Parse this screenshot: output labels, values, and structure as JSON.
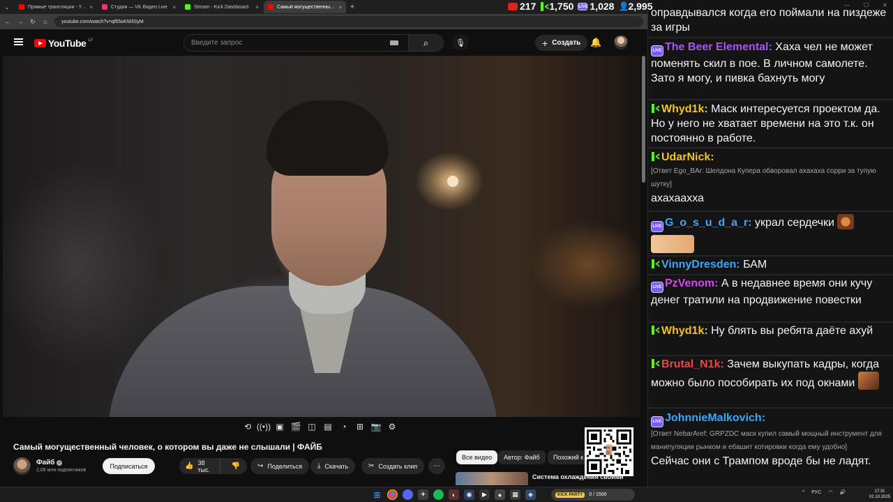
{
  "browser": {
    "tabs": [
      {
        "label": "Прямые трансляции - YouTube",
        "color": "#ff0000"
      },
      {
        "label": "Студия — VK Видео Live",
        "color": "#ff3366"
      },
      {
        "label": "Stream - Kick Dashboard",
        "color": "#53fc18"
      },
      {
        "label": "Самый могущественный ч",
        "color": "#ff0000",
        "active": true
      }
    ],
    "url": "youtube.com/watch?v=qf65oKM3SyM"
  },
  "counters": [
    {
      "platform": "youtube",
      "value": "217"
    },
    {
      "platform": "kick",
      "value": "1,750"
    },
    {
      "platform": "vk-live",
      "value": "1,028",
      "badge": "LIVE"
    },
    {
      "platform": "viewers-total",
      "value": "2,995"
    }
  ],
  "youtube": {
    "logo": "YouTube",
    "region": "LV",
    "search_placeholder": "Введите запрос",
    "create_label": "Создать",
    "video_title": "Самый могущественный человек, о котором вы даже не слышали | ФАЙБ",
    "channel_name": "Файб",
    "channel_subs": "2,08 млн подписчиков",
    "subscribe_label": "Подписаться",
    "likes": "38 тыс.",
    "share_label": "Поделиться",
    "download_label": "Скачать",
    "clip_label": "Создать клип",
    "chips": [
      "Все видео",
      "Автор: Файб",
      "Похожий к"
    ],
    "related_title": "Система охлаждения своими"
  },
  "chat": {
    "messages": [
      {
        "platform": "none",
        "user": "",
        "color": "#ffffff",
        "text": "оправдывался когда его поймали на пиздеже за игры",
        "reply": ""
      },
      {
        "platform": "vk",
        "user": "The Beer Elemental:",
        "color": "#a855f7",
        "text": "Хаха чел не может поменять скил в пое. В личном самолете. Зато я могу, и пивка бахнуть могу",
        "reply": ""
      },
      {
        "platform": "kick",
        "user": "Whyd1k:",
        "color": "#f5c518",
        "text": "Маск интересуется проектом да. Но у него не хватает времени на это т.к. он постоянно в работе.",
        "reply": ""
      },
      {
        "platform": "kick",
        "user": "UdarNick:",
        "color": "#f5c518",
        "text": "ахахаахха",
        "reply": "[Ответ Ego_BAr: Шелдона Купера обворовал ахахаха сорри за тупую шутку]"
      },
      {
        "platform": "vk",
        "user": "G_o_s_u_d_a_r:",
        "color": "#3ea6ff",
        "text": "украл сердечки",
        "reply": ""
      },
      {
        "platform": "kick",
        "user": "VinnyDresden:",
        "color": "#3ea6ff",
        "text": "БАМ",
        "reply": ""
      },
      {
        "platform": "vk",
        "user": "PzVenom:",
        "color": "#d946ef",
        "text": "А в недавнее время они кучу денег тратили на продвижение повестки",
        "reply": ""
      },
      {
        "platform": "kick",
        "user": "Whyd1k:",
        "color": "#f5c518",
        "text": "Ну блять вы ребята даёте ахуй",
        "reply": ""
      },
      {
        "platform": "kick",
        "user": "Brutal_N1k:",
        "color": "#ef4444",
        "text": "Зачем выкупать кадры, когда можно было пособирать их под окнами",
        "reply": ""
      },
      {
        "platform": "vk",
        "user": "JohnnieMalkovich:",
        "color": "#3ea6ff",
        "text": "Сейчас они с Трампом вроде бы не ладят.",
        "reply": "[Ответ NebarAref: GRPZDC маск купил самый мощный инструмент для манипуляции рынком и ебашит котировки когда ему удобно]"
      }
    ]
  },
  "taskbar": {
    "kick_badge": "KICK PARTY",
    "kick_progress": "0 / 1500",
    "lang": "РУС",
    "time": "17:31",
    "date": "02.10.2025"
  }
}
